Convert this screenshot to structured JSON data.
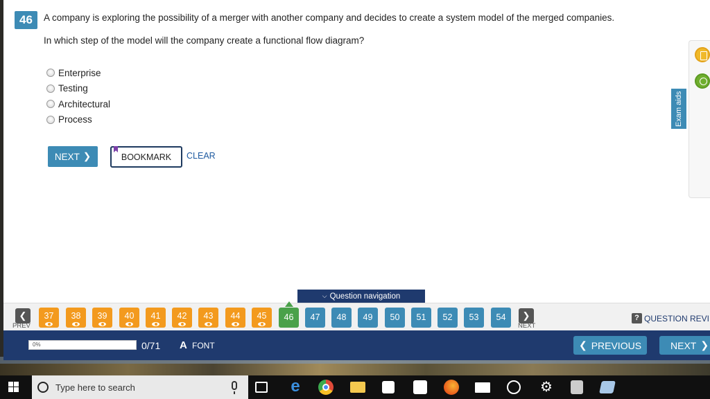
{
  "question": {
    "number": "46",
    "text": "A company is exploring the possibility of a merger with another company and decides to create a system model of the merged companies.",
    "prompt": "In which step of the model will the company create a functional flow diagram?",
    "options": [
      "Enterprise",
      "Testing",
      "Architectural",
      "Process"
    ]
  },
  "actions": {
    "next_label": "NEXT",
    "bookmark_label": "BOOKMARK",
    "clear_label": "CLEAR"
  },
  "exam_aids": {
    "label": "Exam aids",
    "tools": [
      "calculator-icon",
      "timer-icon"
    ]
  },
  "navigation": {
    "tab_label": "Question navigation",
    "prev_label": "PREV",
    "next_label": "NEXT",
    "current": "46",
    "answered": [
      "37",
      "38",
      "39",
      "40",
      "41",
      "42",
      "43",
      "44",
      "45"
    ],
    "unanswered": [
      "47",
      "48",
      "49",
      "50",
      "51",
      "52",
      "53",
      "54"
    ],
    "review_label": "QUESTION REVIEW"
  },
  "footer": {
    "progress_percent": "0%",
    "progress_value": 0,
    "progress_count": "0/71",
    "font_icon": "A",
    "font_label": "FONT",
    "previous_label": "PREVIOUS",
    "next_label": "NEXT"
  },
  "taskbar": {
    "search_placeholder": "Type here to search",
    "icons": [
      "start-icon",
      "task-view-icon",
      "edge-icon",
      "chrome-icon",
      "file-explorer-icon",
      "store-icon",
      "calendar-icon",
      "firefox-icon",
      "mail-icon",
      "alarm-icon",
      "settings-icon",
      "calculator-icon",
      "note-icon"
    ]
  },
  "colors": {
    "primary": "#3d8bb5",
    "navy": "#1f3a6e",
    "answered": "#f39a1e",
    "current": "#4aa14a"
  }
}
